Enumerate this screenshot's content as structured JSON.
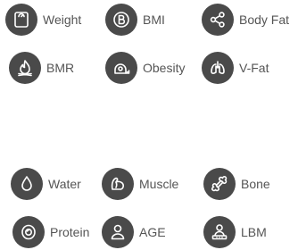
{
  "metrics": {
    "weight": {
      "label": "Weight",
      "icon": "scale-icon"
    },
    "bmi": {
      "label": "BMI",
      "icon": "bmi-b-icon"
    },
    "body_fat": {
      "label": "Body Fat",
      "icon": "share-nodes-icon"
    },
    "bmr": {
      "label": "BMR",
      "icon": "flame-icon"
    },
    "obesity": {
      "label": "Obesity",
      "icon": "tape-measure-icon"
    },
    "v_fat": {
      "label": "V-Fat",
      "icon": "lungs-icon"
    },
    "water": {
      "label": "Water",
      "icon": "water-drop-icon"
    },
    "muscle": {
      "label": "Muscle",
      "icon": "flexed-arm-icon"
    },
    "bone": {
      "label": "Bone",
      "icon": "bone-icon"
    },
    "protein": {
      "label": "Protein",
      "icon": "protein-egg-icon"
    },
    "age": {
      "label": "AGE",
      "icon": "person-icon"
    },
    "lbm": {
      "label": "LBM",
      "icon": "person-on-scale-icon"
    }
  },
  "colors": {
    "icon_background": "#4a4a4a",
    "icon_foreground": "#ffffff",
    "label_text": "#555555",
    "page_background": "#ffffff"
  }
}
